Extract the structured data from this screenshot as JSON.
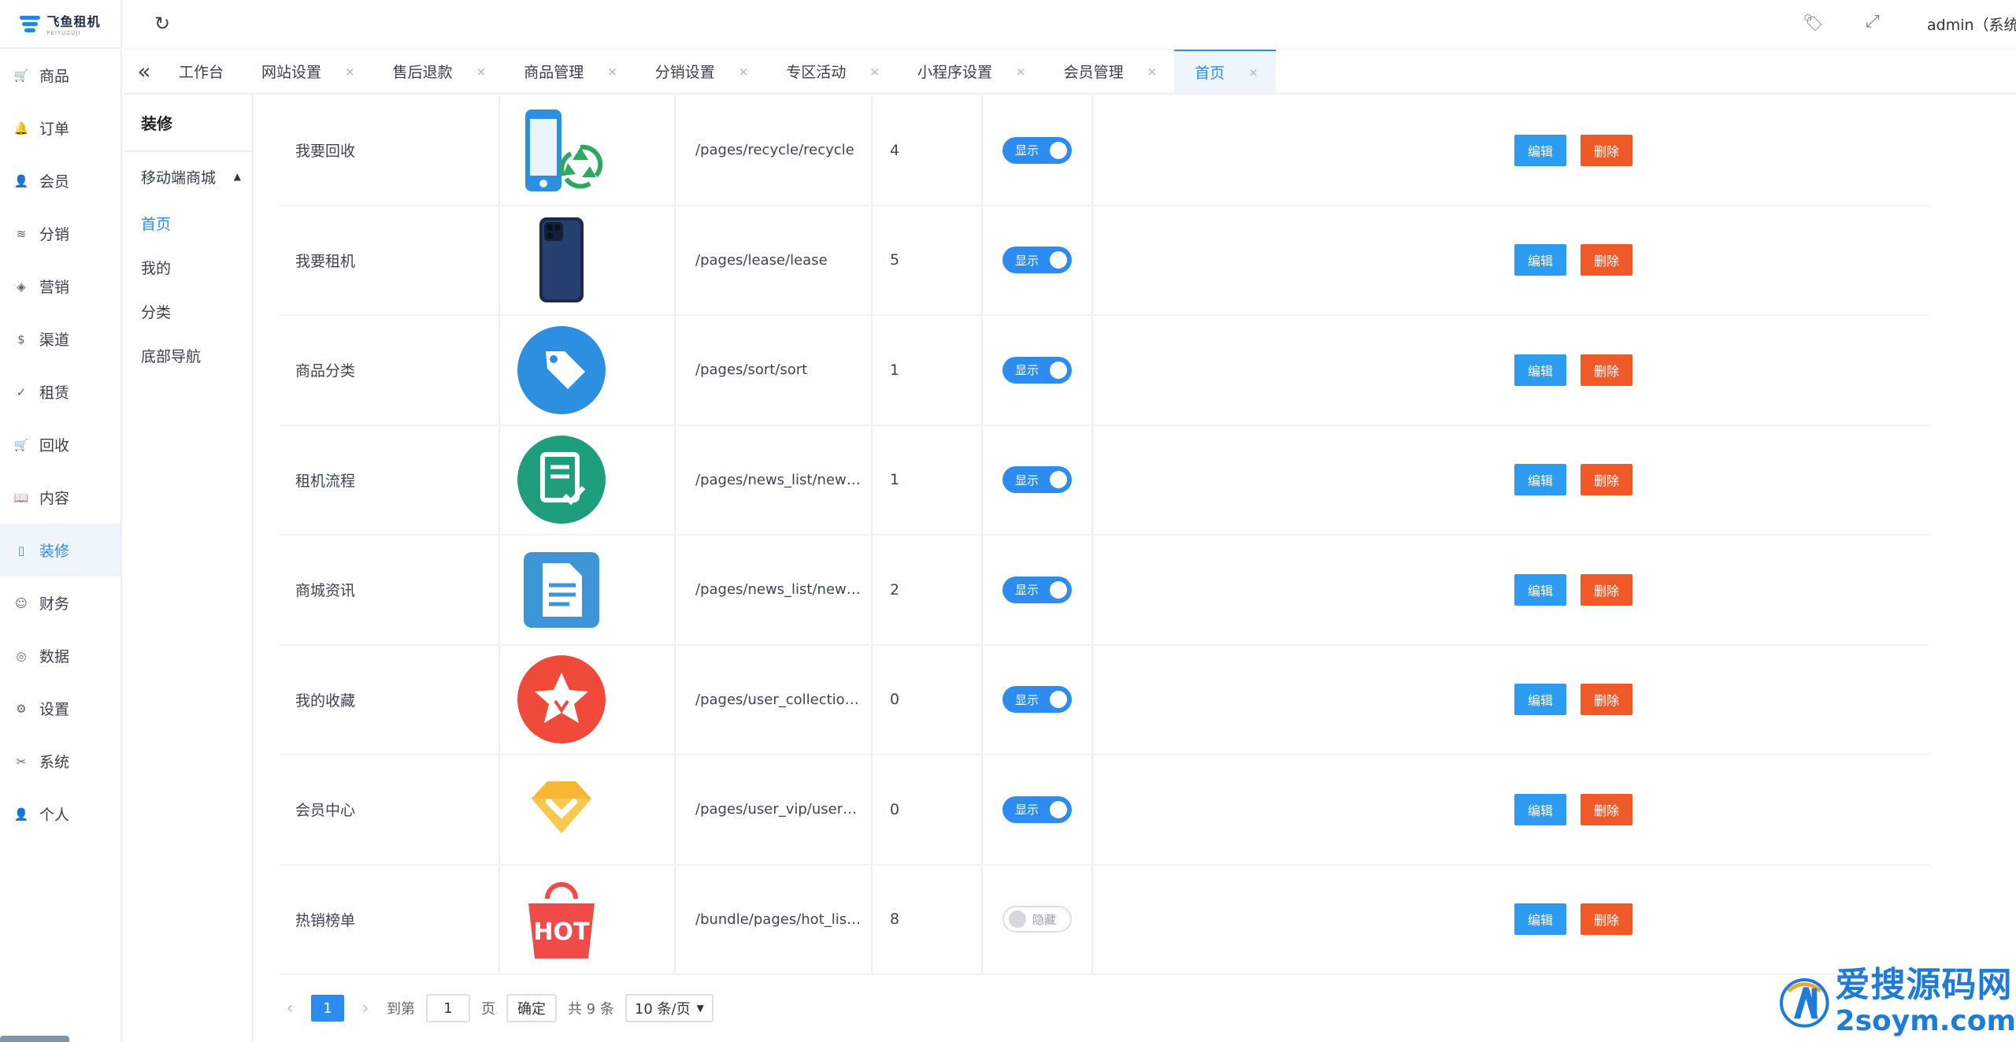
{
  "brand": {
    "name": "飞鱼租机",
    "tagline": "FEIYUZUJI"
  },
  "nav": [
    {
      "label": "商品",
      "icon": "cart-icon",
      "glyph": "🛒"
    },
    {
      "label": "订单",
      "icon": "bell-icon",
      "glyph": "🔔"
    },
    {
      "label": "会员",
      "icon": "user-icon",
      "glyph": "👤"
    },
    {
      "label": "分销",
      "icon": "layers-icon",
      "glyph": "≋"
    },
    {
      "label": "营销",
      "icon": "diamond-icon",
      "glyph": "◈"
    },
    {
      "label": "渠道",
      "icon": "coin-icon",
      "glyph": "$"
    },
    {
      "label": "租赁",
      "icon": "check-shield-icon",
      "glyph": "✓"
    },
    {
      "label": "回收",
      "icon": "cart-icon",
      "glyph": "🛒"
    },
    {
      "label": "内容",
      "icon": "book-icon",
      "glyph": "📖"
    },
    {
      "label": "装修",
      "icon": "tablet-icon",
      "glyph": "▯",
      "active": true
    },
    {
      "label": "财务",
      "icon": "wallet-icon",
      "glyph": "☺"
    },
    {
      "label": "数据",
      "icon": "database-icon",
      "glyph": "◎"
    },
    {
      "label": "设置",
      "icon": "gear-icon",
      "glyph": "⚙"
    },
    {
      "label": "系统",
      "icon": "tools-icon",
      "glyph": "✂"
    },
    {
      "label": "个人",
      "icon": "person-icon",
      "glyph": "👤"
    }
  ],
  "header": {
    "user": "admin（系统"
  },
  "tabs": [
    {
      "label": "工作台",
      "closable": false
    },
    {
      "label": "网站设置",
      "closable": true
    },
    {
      "label": "售后退款",
      "closable": true
    },
    {
      "label": "商品管理",
      "closable": true
    },
    {
      "label": "分销设置",
      "closable": true
    },
    {
      "label": "专区活动",
      "closable": true
    },
    {
      "label": "小程序设置",
      "closable": true
    },
    {
      "label": "会员管理",
      "closable": true
    },
    {
      "label": "首页",
      "closable": true,
      "active": true
    }
  ],
  "submenu": {
    "title": "装修",
    "group": "移动端商城",
    "items": [
      {
        "label": "首页",
        "active": true
      },
      {
        "label": "我的"
      },
      {
        "label": "分类"
      },
      {
        "label": "底部导航"
      }
    ]
  },
  "table": {
    "rows": [
      {
        "name": "我要回收",
        "icon": "phone-recycle-icon",
        "path": "/pages/recycle/recycle",
        "sort": "4",
        "status": "显示",
        "on": true
      },
      {
        "name": "我要租机",
        "icon": "smartphone-icon",
        "path": "/pages/lease/lease",
        "sort": "5",
        "status": "显示",
        "on": true
      },
      {
        "name": "商品分类",
        "icon": "price-tag-icon",
        "path": "/pages/sort/sort",
        "sort": "1",
        "status": "显示",
        "on": true
      },
      {
        "name": "租机流程",
        "icon": "checklist-doc-icon",
        "path": "/pages/news_list/news_list",
        "sort": "1",
        "status": "显示",
        "on": true
      },
      {
        "name": "商城资讯",
        "icon": "document-icon",
        "path": "/pages/news_list/news_list",
        "sort": "2",
        "status": "显示",
        "on": true
      },
      {
        "name": "我的收藏",
        "icon": "star-icon",
        "path": "/pages/user_collection/user_collection",
        "sort": "0",
        "status": "显示",
        "on": true
      },
      {
        "name": "会员中心",
        "icon": "vip-diamond-icon",
        "path": "/pages/user_vip/user_vip",
        "sort": "0",
        "status": "显示",
        "on": true
      },
      {
        "name": "热销榜单",
        "icon": "hot-bag-icon",
        "path": "/bundle/pages/hot_list/hot_list",
        "sort": "8",
        "status": "隐藏",
        "on": false
      }
    ],
    "edit_label": "编辑",
    "delete_label": "删除"
  },
  "pagination": {
    "current": "1",
    "goto_label": "到第",
    "goto_value": "1",
    "page_unit": "页",
    "confirm_label": "确定",
    "total": "共 9 条",
    "page_size": "10 条/页"
  },
  "watermark": {
    "cn": "爱搜源码网",
    "en": "2soym.com"
  },
  "colors": {
    "primary": "#2d8cf0",
    "danger": "#f05a28",
    "edit": "#2d9cf0"
  }
}
